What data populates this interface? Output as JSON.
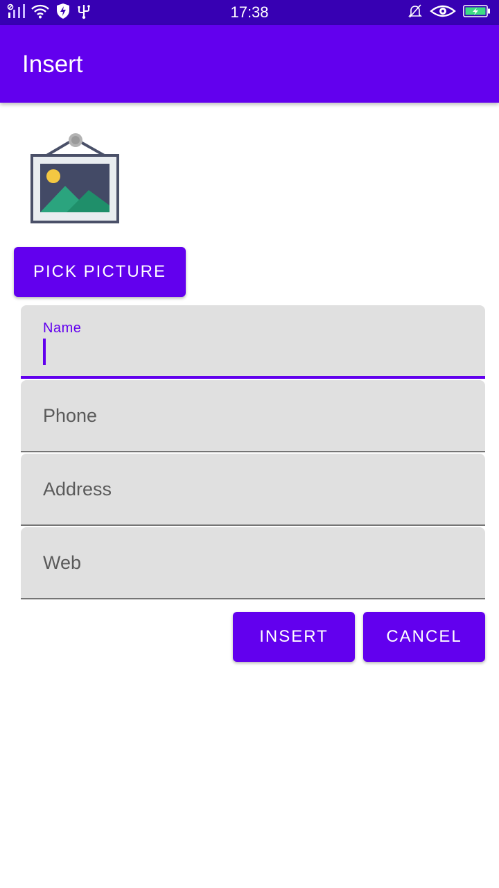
{
  "status_bar": {
    "time": "17:38",
    "icons": [
      "signal-icon",
      "wifi-icon",
      "shield-icon",
      "usb-icon",
      "bell-off-icon",
      "eye-icon",
      "battery-charging-icon"
    ],
    "background": "#3700b3"
  },
  "app_bar": {
    "title": "Insert",
    "background": "#6200ee"
  },
  "picture": {
    "icon": "framed-picture-icon"
  },
  "buttons": {
    "pick_picture": "PICK PICTURE",
    "insert": "INSERT",
    "cancel": "CANCEL"
  },
  "form": {
    "name": {
      "label": "Name",
      "value": "",
      "focused": true
    },
    "phone": {
      "label": "Phone",
      "value": ""
    },
    "address": {
      "label": "Address",
      "value": ""
    },
    "web": {
      "label": "Web",
      "value": ""
    }
  },
  "colors": {
    "primary": "#6200ee",
    "primary_dark": "#3700b3",
    "field_background": "#e0e0e0"
  }
}
